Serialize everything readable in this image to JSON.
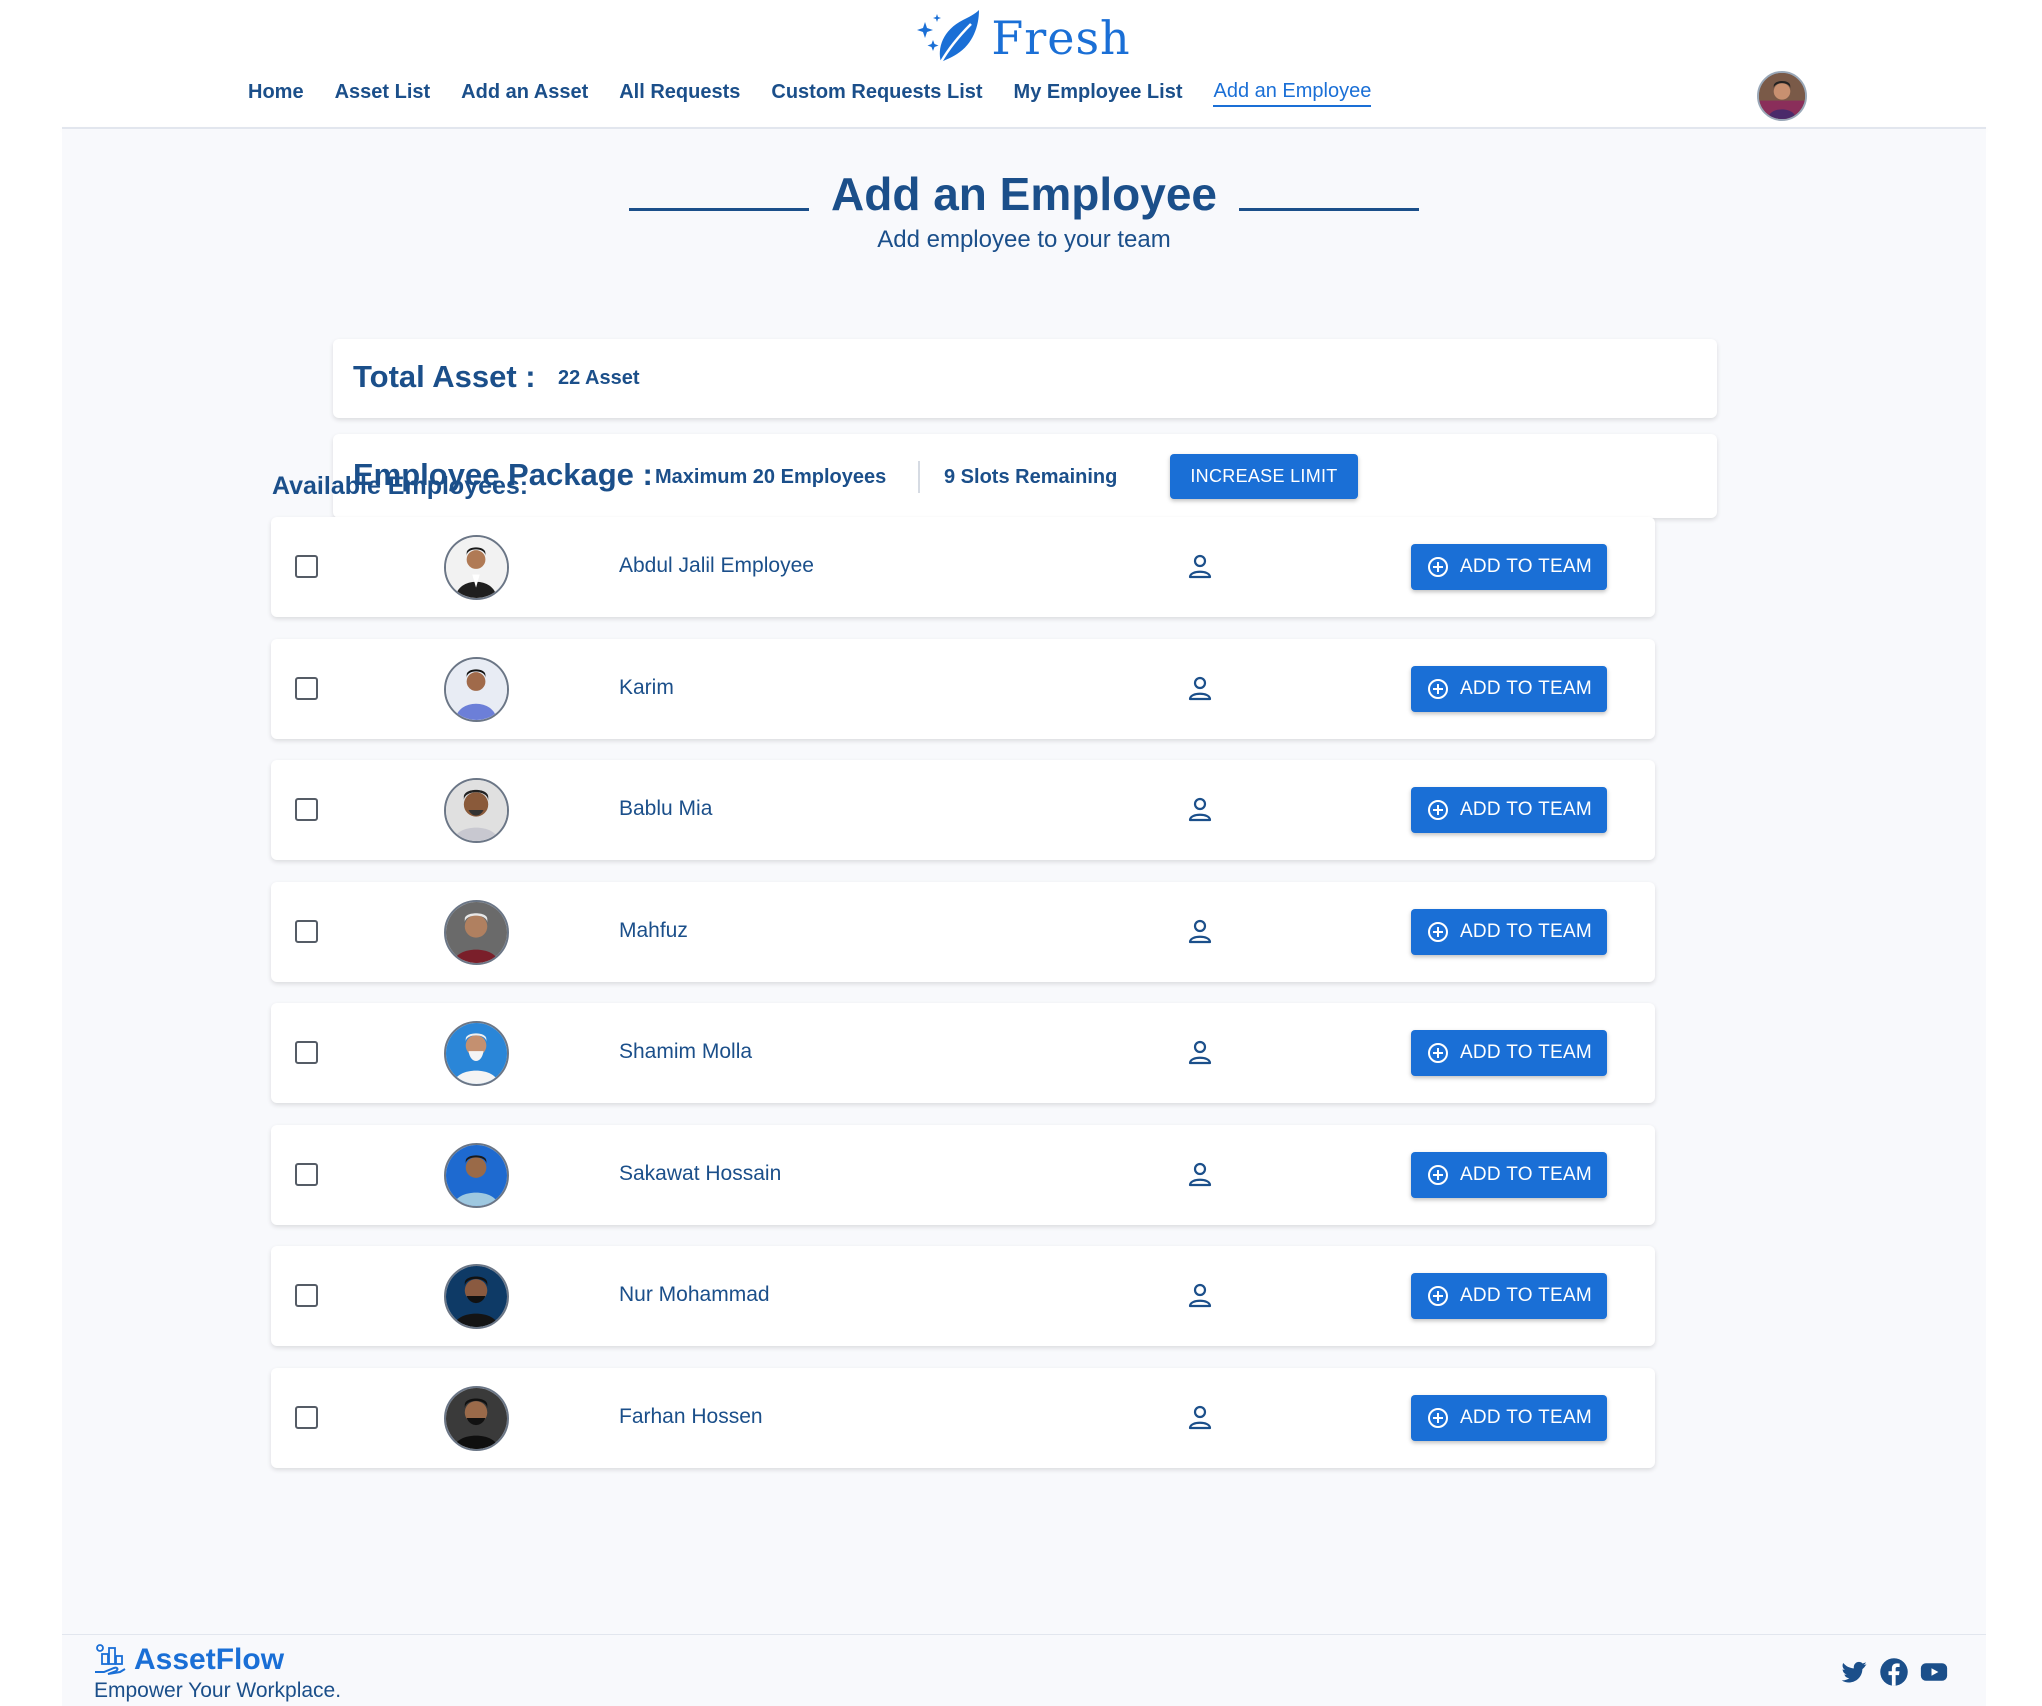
{
  "brand": {
    "name": "Fresh"
  },
  "nav": {
    "items": [
      {
        "label": "Home",
        "active": false
      },
      {
        "label": "Asset List",
        "active": false
      },
      {
        "label": "Add an Asset",
        "active": false
      },
      {
        "label": "All Requests",
        "active": false
      },
      {
        "label": "Custom Requests List",
        "active": false
      },
      {
        "label": "My Employee List",
        "active": false
      },
      {
        "label": "Add an Employee",
        "active": true
      }
    ]
  },
  "page": {
    "title": "Add an Employee",
    "subtitle": "Add employee to your team"
  },
  "total_asset": {
    "label": "Total Asset :",
    "value": "22 Asset"
  },
  "package": {
    "label": "Employee Package :",
    "max": "Maximum 20 Employees",
    "slots": "9 Slots Remaining",
    "button_label": "INCREASE LIMIT"
  },
  "available": {
    "label": "Available Employees:",
    "add_button_label": "ADD TO TEAM",
    "employees": [
      {
        "name": "Abdul Jalil Employee",
        "checked": false
      },
      {
        "name": "Karim",
        "checked": false
      },
      {
        "name": "Bablu Mia",
        "checked": false
      },
      {
        "name": "Mahfuz",
        "checked": false
      },
      {
        "name": "Shamim Molla",
        "checked": false
      },
      {
        "name": "Sakawat Hossain",
        "checked": false
      },
      {
        "name": "Nur Mohammad",
        "checked": false
      },
      {
        "name": "Farhan Hossen",
        "checked": false
      }
    ]
  },
  "footer": {
    "brand": "AssetFlow",
    "tagline": "Empower Your Workplace.",
    "social_icons": [
      "twitter-icon",
      "facebook-icon",
      "youtube-icon"
    ]
  },
  "colors": {
    "primary": "#1a6fd6",
    "text": "#1b4f8a",
    "background": "#f8f9fc"
  }
}
